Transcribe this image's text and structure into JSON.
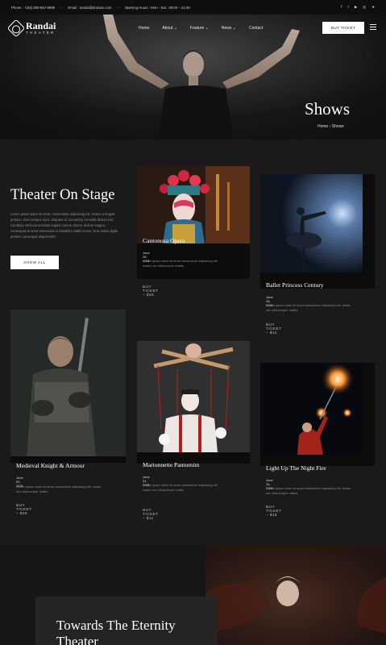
{
  "topbar": {
    "phone": "Phone : +(62) 800-567-8990",
    "email": "Email : randai@domain.com",
    "hours": "Opening Hours : Mon - Sat : 09:00 – 21:00",
    "social_icons": [
      "facebook-icon",
      "twitter-icon",
      "youtube-icon",
      "dribbble-icon",
      "telegram-icon"
    ],
    "social_glyphs": [
      "f",
      "t",
      "▶",
      "◎",
      "➤"
    ]
  },
  "header": {
    "logo_name": "Randai",
    "logo_sub": "THEATER",
    "menu": [
      "Home",
      "About",
      "Feature",
      "News",
      "Contact"
    ],
    "menu_dropdown": [
      false,
      true,
      true,
      true,
      false
    ],
    "buy_ticket": "BUY TICKET"
  },
  "hero": {
    "title": "Shows",
    "breadcrumb_home": "Home",
    "breadcrumb_sep": "›",
    "breadcrumb_current": "Shows"
  },
  "intro": {
    "title": "Theater On Stage",
    "text": "Lorem ipsum dolor sit amet, consectetur adipiscing elit. Donec a feugiat pretium. Duis tempus nunc, aliquam id, nonummy convallis dictum nisi. Curabitur vehicula tincidunt sapien cursus. Donec dictum magna, consequat sit amet necessitas in blanditiis mattis lectus. Duis mattis ligula pretium consequat aliquet nibh.",
    "button": "SHOW ALL"
  },
  "shows": [
    {
      "title": "Cantonosa Opera",
      "date": "June 28, 2021",
      "desc": "Lorem ipsum dolor sit amet consectetur adipiscing elit. Iustus nec ullamcorper mattis.",
      "buy": "BUY TICKET – $20"
    },
    {
      "title": "Ballet Princess Century",
      "date": "June 26, 2021",
      "desc": "Lorem ipsum dolor sit amet consectetur adipiscing elit. Iustus nec ullamcorper mattis.",
      "buy": "BUY TICKET – $14"
    },
    {
      "title": "Medieval Knight & Armour",
      "date": "June 09, 2021",
      "desc": "Lorem ipsum dolor sit amet consectetur adipiscing elit. Iustus nec ullamcorper mattis.",
      "buy": "BUY TICKET – $29"
    },
    {
      "title": "Marionnette Pantomim",
      "date": "June 01, 2021",
      "desc": "Lorem ipsum dolor sit amet consectetur adipiscing elit. Iustus nec ullamcorper mattis.",
      "buy": "BUY TICKET – $11"
    },
    {
      "title": "Light Up The Night Fire",
      "date": "June 15, 2021",
      "desc": "Lorem ipsum dolor sit amet consectetur adipiscing elit. Iustus nec ullamcorper mattis.",
      "buy": "BUY TICKET – $15"
    }
  ],
  "bottom": {
    "heading": "Towards The Eternity Theater"
  },
  "colors": {
    "background": "#1a1a1a",
    "card_shadow": "#0c0c0c",
    "accent_fire": "#ff9a3a"
  }
}
